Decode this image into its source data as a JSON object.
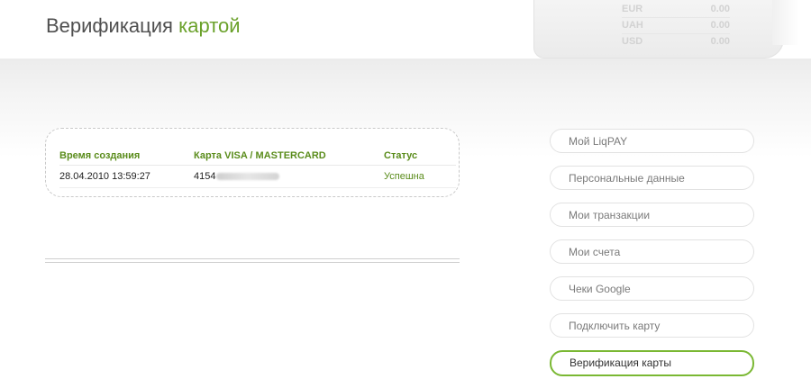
{
  "header": {
    "title_part1": "Верификация",
    "title_part2": "картой"
  },
  "balance": [
    {
      "currency": "EUR",
      "amount": "0.00"
    },
    {
      "currency": "UAH",
      "amount": "0.00"
    },
    {
      "currency": "USD",
      "amount": "0.00"
    }
  ],
  "history": {
    "columns": [
      "Время создания",
      "Карта VISA / MASTERCARD",
      "Статус"
    ],
    "rows": [
      {
        "time": "28.04.2010 13:59:27",
        "card_prefix": "4154",
        "status": "Успешна"
      }
    ]
  },
  "nav": {
    "items": [
      {
        "label": "Мой LiqPAY"
      },
      {
        "label": "Персональные данные"
      },
      {
        "label": "Мои транзакции"
      },
      {
        "label": "Мои счета"
      },
      {
        "label": "Чеки Google"
      },
      {
        "label": "Подключить карту"
      },
      {
        "label": "Верификация карты",
        "active": true
      }
    ]
  },
  "colors": {
    "accent": "#6aa12a",
    "active_border": "#7ab833",
    "status": "#5a8c1b"
  }
}
